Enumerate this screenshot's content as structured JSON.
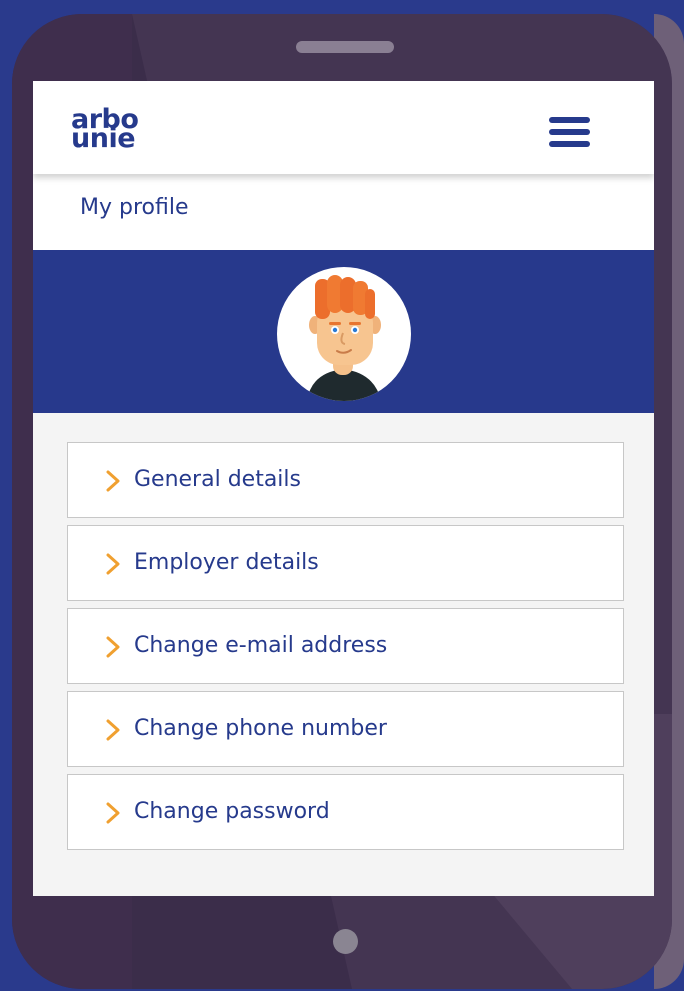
{
  "brand": {
    "logo_line1": "arbo",
    "logo_line2": "unie"
  },
  "header": {
    "menu_icon": "hamburger-menu-icon"
  },
  "page": {
    "title": "My profile"
  },
  "profile": {
    "avatar_icon": "user-avatar-illustration"
  },
  "menu": {
    "items": [
      {
        "label": "General details",
        "icon": "chevron-right-icon"
      },
      {
        "label": "Employer details",
        "icon": "chevron-right-icon"
      },
      {
        "label": "Change e-mail address",
        "icon": "chevron-right-icon"
      },
      {
        "label": "Change phone number",
        "icon": "chevron-right-icon"
      },
      {
        "label": "Change password",
        "icon": "chevron-right-icon"
      }
    ]
  },
  "colors": {
    "background": "#2a3a8c",
    "brand_blue": "#263a8c",
    "banner": "#27398c",
    "chevron": "#f0a030",
    "phone_body": "#3b2d4a"
  }
}
